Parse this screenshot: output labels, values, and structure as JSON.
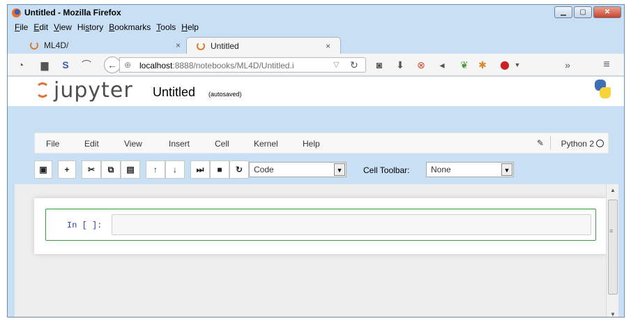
{
  "window": {
    "title": "Untitled - Mozilla Firefox"
  },
  "menu": [
    {
      "label": "File",
      "u": "F",
      "rest": "ile"
    },
    {
      "label": "Edit",
      "u": "E",
      "rest": "dit"
    },
    {
      "label": "View",
      "u": "V",
      "rest": "iew"
    },
    {
      "label": "History",
      "pre": "Hi",
      "u": "s",
      "rest": "tory"
    },
    {
      "label": "Bookmarks",
      "u": "B",
      "rest": "ookmarks"
    },
    {
      "label": "Tools",
      "u": "T",
      "rest": "ools"
    },
    {
      "label": "Help",
      "u": "H",
      "rest": "elp"
    }
  ],
  "tabs": [
    {
      "label": "ML4D/",
      "close": "×"
    },
    {
      "label": "Untitled",
      "close": "×"
    }
  ],
  "url": {
    "host": "localhost",
    "rest": ":8888/notebooks/ML4D/Untitled.i"
  },
  "nb": {
    "logo_text": "jupyter",
    "title": "Untitled",
    "saved": "(autosaved)",
    "menu": [
      "File",
      "Edit",
      "View",
      "Insert",
      "Cell",
      "Kernel",
      "Help"
    ],
    "kernel": "Python 2"
  },
  "toolbar": {
    "cell_type": "Code",
    "cell_toolbar_label": "Cell Toolbar:",
    "cell_toolbar_value": "None"
  },
  "cell": {
    "prompt": "In [ ]:",
    "code": ""
  }
}
